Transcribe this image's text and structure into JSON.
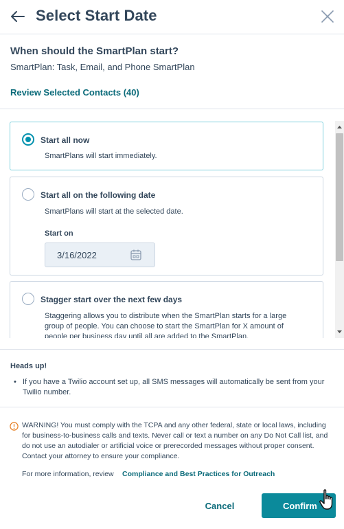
{
  "header": {
    "title": "Select Start Date",
    "back_icon": "arrow-left-icon",
    "close_icon": "close-icon"
  },
  "intro": {
    "question": "When should the SmartPlan start?",
    "smartplan_name": "SmartPlan: Task, Email, and Phone SmartPlan",
    "review_link": "Review Selected Contacts (40)"
  },
  "options": [
    {
      "label": "Start all now",
      "description": "SmartPlans will start immediately.",
      "selected": true
    },
    {
      "label": "Start all on the following date",
      "description": "SmartPlans will start at the selected date.",
      "start_on_label": "Start on",
      "date_value": "3/16/2022",
      "selected": false
    },
    {
      "label": "Stagger start over the next few days",
      "description": "Staggering allows you to distribute when the SmartPlan starts for a large group of people. You can choose to start the SmartPlan for X amount of people per business day until all are added to the SmartPlan.",
      "selected": false
    }
  ],
  "heads_up": {
    "title": "Heads up!",
    "items": [
      "If you have a Twilio account set up, all SMS messages will automatically be sent from your Twilio number."
    ]
  },
  "warning": {
    "icon": "warning-circle-icon",
    "text": "WARNING! You must comply with the TCPA and any other federal, state or local laws, including for business-to-business calls and texts. Never call or text a number on any Do Not Call list, and do not use an autodialer or artificial voice or prerecorded messages without proper consent. Contact your attorney to ensure your compliance.",
    "more_info_prefix": "For more information, review",
    "more_info_link": "Compliance and Best Practices for Outreach"
  },
  "footer": {
    "cancel_label": "Cancel",
    "confirm_label": "Confirm"
  },
  "colors": {
    "accent": "#0b8a9b",
    "link": "#0b6b7a",
    "text": "#33475b",
    "radio_selected": "#0091ae",
    "warning_orange": "#e67e22"
  }
}
